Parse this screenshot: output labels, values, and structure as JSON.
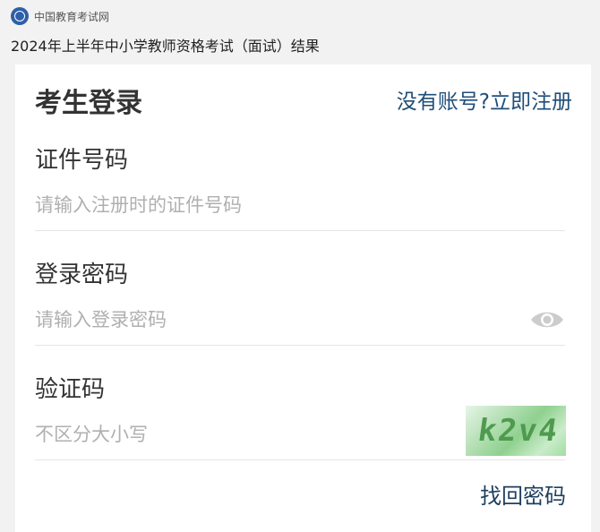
{
  "header": {
    "site_name": "中国教育考试网",
    "page_title": "2024年上半年中小学教师资格考试（面试）结果"
  },
  "login": {
    "title": "考生登录",
    "register_link": "没有账号?立即注册",
    "id_field": {
      "label": "证件号码",
      "placeholder": "请输入注册时的证件号码",
      "value": ""
    },
    "password_field": {
      "label": "登录密码",
      "placeholder": "请输入登录密码",
      "value": ""
    },
    "captcha_field": {
      "label": "验证码",
      "placeholder": "不区分大小写",
      "value": "",
      "image_text": "k2v4"
    },
    "forgot_link": "找回密码"
  },
  "colors": {
    "link": "#1f4e79",
    "placeholder": "#b0b0b0",
    "captcha_bg": "#8fd08f"
  },
  "icons": [
    "site-logo-icon",
    "eye-icon"
  ]
}
